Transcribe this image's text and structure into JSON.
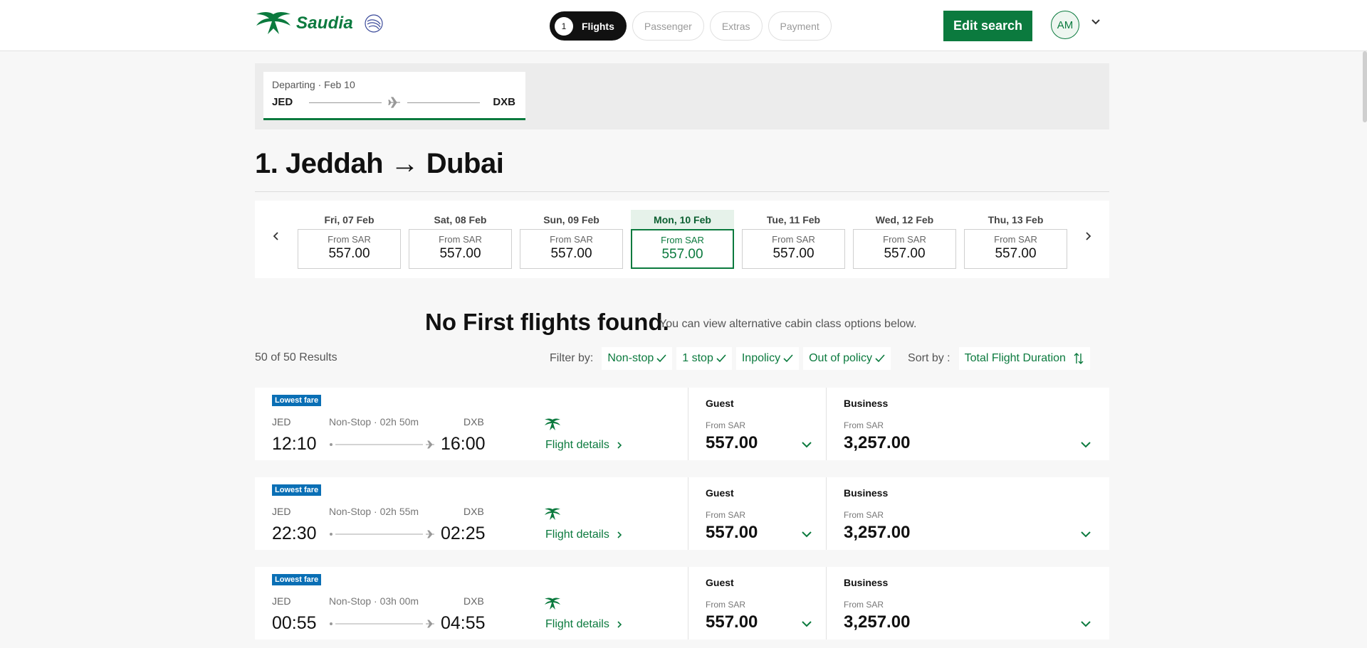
{
  "header": {
    "brand": "Saudia",
    "steps": [
      {
        "num": "1",
        "label": "Flights"
      },
      {
        "label": "Passenger"
      },
      {
        "label": "Extras"
      },
      {
        "label": "Payment"
      }
    ],
    "edit_search": "Edit search",
    "avatar_initials": "AM"
  },
  "route": {
    "label": "Departing · Feb 10",
    "from": "JED",
    "to": "DXB"
  },
  "page_title": "1. Jeddah → Dubai",
  "dates": [
    {
      "day": "Fri, 07 Feb",
      "from": "From SAR",
      "price": "557.00",
      "selected": false
    },
    {
      "day": "Sat, 08 Feb",
      "from": "From SAR",
      "price": "557.00",
      "selected": false
    },
    {
      "day": "Sun, 09 Feb",
      "from": "From SAR",
      "price": "557.00",
      "selected": false
    },
    {
      "day": "Mon, 10 Feb",
      "from": "From SAR",
      "price": "557.00",
      "selected": true
    },
    {
      "day": "Tue, 11 Feb",
      "from": "From SAR",
      "price": "557.00",
      "selected": false
    },
    {
      "day": "Wed, 12 Feb",
      "from": "From SAR",
      "price": "557.00",
      "selected": false
    },
    {
      "day": "Thu, 13 Feb",
      "from": "From SAR",
      "price": "557.00",
      "selected": false
    }
  ],
  "no_results": {
    "heading": "No First flights found.",
    "sub": "You can view alternative cabin class options below."
  },
  "results_count": "50 of 50 Results",
  "filters": {
    "label": "Filter by:",
    "chips": [
      "Non-stop",
      "1 stop",
      "Inpolicy",
      "Out of policy"
    ]
  },
  "sort": {
    "label": "Sort by :",
    "value": "Total Flight Duration"
  },
  "flights": [
    {
      "badge": "Lowest fare",
      "dep_code": "JED",
      "arr_code": "DXB",
      "stop_info": "Non-Stop · 02h 50m",
      "dep_time": "12:10",
      "arr_time": "16:00",
      "details": "Flight details",
      "guest": {
        "name": "Guest",
        "from": "From SAR",
        "price": "557.00"
      },
      "business": {
        "name": "Business",
        "from": "From SAR",
        "price": "3,257.00"
      }
    },
    {
      "badge": "Lowest fare",
      "dep_code": "JED",
      "arr_code": "DXB",
      "stop_info": "Non-Stop · 02h 55m",
      "dep_time": "22:30",
      "arr_time": "02:25",
      "details": "Flight details",
      "guest": {
        "name": "Guest",
        "from": "From SAR",
        "price": "557.00"
      },
      "business": {
        "name": "Business",
        "from": "From SAR",
        "price": "3,257.00"
      }
    },
    {
      "badge": "Lowest fare",
      "dep_code": "JED",
      "arr_code": "DXB",
      "stop_info": "Non-Stop · 03h 00m",
      "dep_time": "00:55",
      "arr_time": "04:55",
      "details": "Flight details",
      "guest": {
        "name": "Guest",
        "from": "From SAR",
        "price": "557.00"
      },
      "business": {
        "name": "Business",
        "from": "From SAR",
        "price": "3,257.00"
      }
    }
  ],
  "colors": {
    "brand": "#0b7a3e",
    "badge": "#0a6fb5"
  }
}
